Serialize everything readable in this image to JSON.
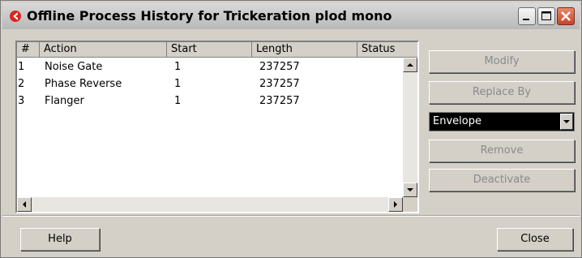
{
  "window": {
    "title": "Offline Process History for Trickeration plod mono",
    "buttons": {
      "minimize": "minimize",
      "maximize": "maximize",
      "close": "close"
    }
  },
  "list": {
    "columns": [
      "#",
      "Action",
      "Start",
      "Length",
      "Status"
    ],
    "rows": [
      {
        "num": "1",
        "action": "Noise Gate",
        "start": "1",
        "length": "237257",
        "status": ""
      },
      {
        "num": "2",
        "action": "Phase Reverse",
        "start": "1",
        "length": "237257",
        "status": ""
      },
      {
        "num": "3",
        "action": "Flanger",
        "start": "1",
        "length": "237257",
        "status": ""
      }
    ]
  },
  "side_panel": {
    "modify_label": "Modify",
    "replace_by_label": "Replace By",
    "effect_select_value": "Envelope",
    "remove_label": "Remove",
    "deactivate_label": "Deactivate"
  },
  "footer": {
    "help_label": "Help",
    "close_label": "Close"
  },
  "colors": {
    "face": "#d4d0c8",
    "titlebar": "#c8c8c8",
    "close_button": "#c8422a",
    "app_icon": "#d8261c"
  }
}
